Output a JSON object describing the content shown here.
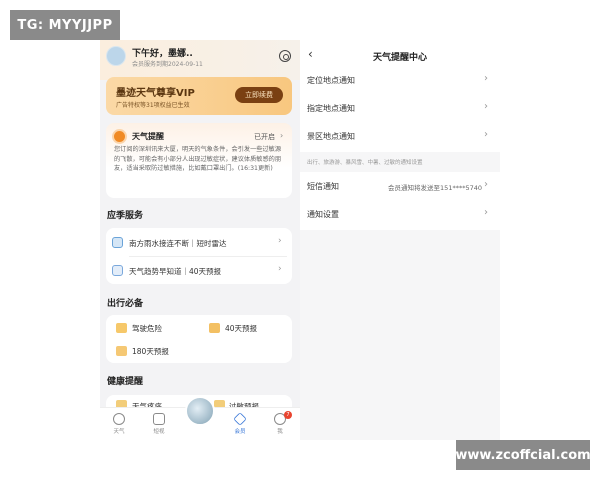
{
  "watermark_top": "TG: MYYJJPP",
  "watermark_bottom": "www.zcoffcial.com",
  "left": {
    "greeting": "下午好，墨娜..",
    "member_expiry": "会员服务到期2024-09-11",
    "vip": {
      "title": "墨迹天气尊享VIP",
      "subtitle": "广告特权等31项权益已生效",
      "renew_label": "立即续费"
    },
    "weather_alert": {
      "title": "天气提醒",
      "status": "已开启",
      "body": "您订阅的深圳讯来大厦，明天的气象条件，会引发一些过敏源的飞散，可能会有小部分人出现过敏症状，建议体质敏感的朋友，适当采取防过敏措施，比如戴口罩出门。(16:31更新)"
    },
    "seasonal_title": "应季服务",
    "seasonal_items": [
      {
        "label": "南方雨水接连不断｜短时雷达",
        "icon": "radar-icon"
      },
      {
        "label": "天气趋势早知道｜40天预报",
        "icon": "calendar-icon"
      }
    ],
    "travel_title": "出行必备",
    "travel_items": [
      {
        "label": "驾驶危险",
        "icon": "car-icon"
      },
      {
        "label": "40天预报",
        "icon": "forecast-icon"
      },
      {
        "label": "180天预报",
        "icon": "forecast-long-icon"
      }
    ],
    "health_title": "健康提醒",
    "health_items": [
      {
        "label": "天气疼痛"
      },
      {
        "label": "过敏预报"
      }
    ],
    "nav": {
      "weather": "天气",
      "video": "短视",
      "member": "会员",
      "me": "我",
      "badge_count": "7"
    }
  },
  "right": {
    "title": "天气提醒中心",
    "rows": [
      {
        "label": "定位地点通知"
      },
      {
        "label": "指定地点通知"
      },
      {
        "label": "景区地点通知"
      }
    ],
    "hint": "出行、旅游游、暴风雪、中暑、过敏的通知设置",
    "sms": {
      "label": "短信通知",
      "value": "会员通知将发送至151****5740"
    },
    "settings_label": "通知设置"
  },
  "colors": {
    "vip_gold": "#f8c77f",
    "vip_button": "#7a4012",
    "accent_orange": "#f08a24",
    "badge_red": "#e9442f"
  }
}
